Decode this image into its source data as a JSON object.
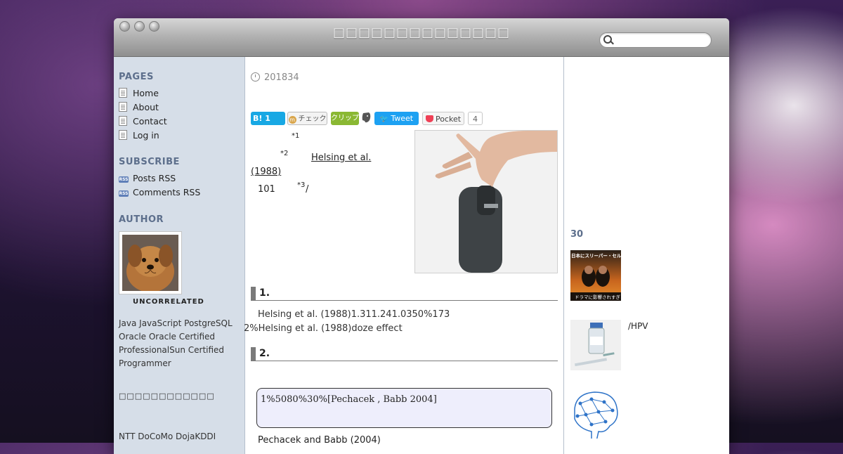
{
  "window": {
    "site_title": "□□□□□□□□□□□□□□",
    "search_placeholder": ""
  },
  "sidebar": {
    "pages_heading": "PAGES",
    "pages": [
      "Home",
      "About",
      "Contact",
      "Log in"
    ],
    "subscribe_heading": "SUBSCRIBE",
    "subscribe": [
      "Posts RSS",
      "Comments RSS"
    ],
    "author_heading": "AUTHOR",
    "author_name": "UNCORRELATED",
    "author_desc": "Java JavaScript PostgreSQL Oracle Oracle Certified ProfessionalSun Certified Programmer",
    "author_extra": "□□□□□□□□□□□□",
    "author_more": "NTT DoCoMo DojaKDDI"
  },
  "post": {
    "date": "201834",
    "share": {
      "hatena": "B!",
      "hatena_count": "1",
      "mixi": "チェック",
      "clip": "クリップ",
      "tweet": "Tweet",
      "pocket": "Pocket",
      "pocket_count": "4"
    },
    "fn1": "*1",
    "fn2": "*2",
    "ref_link_1": "Helsing et al.",
    "ref_link_2": "(1988)",
    "count": "101",
    "fn3": "*3",
    "slash": "/",
    "section1_title": "1.",
    "section1_line1": "Helsing et al. (1988)1.311.241.0350%173",
    "section1_line2": "2%Helsing et al. (1988)doze effect",
    "section2_title": "2.",
    "quote": "1%5080%30%[Pechacek , Babb 2004]",
    "after_quote": "Pechacek and Babb (2004)"
  },
  "related": {
    "heading": "30",
    "items": [
      {
        "caption": ""
      },
      {
        "caption": "/HPV"
      },
      {
        "caption": ""
      }
    ],
    "thumb1_text_top": "日本にスリーパー・セル？",
    "thumb1_text_bottom": "ドラマに影響されすぎ"
  }
}
